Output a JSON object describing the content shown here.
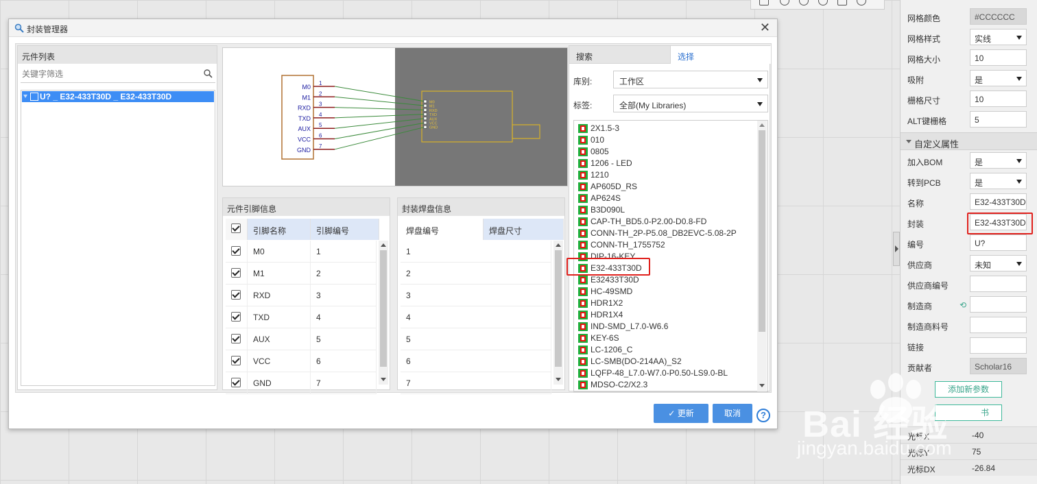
{
  "dialog": {
    "title": "封装管理器",
    "component_list_header": "元件列表",
    "search_placeholder": "关键字筛选",
    "tree_item": "U? _ E32-433T30D _ E32-433T30D",
    "update_label": "更新",
    "cancel_label": "取消",
    "help_label": "?"
  },
  "preview": {
    "pins": [
      {
        "name": "M0",
        "num": "1"
      },
      {
        "name": "M1",
        "num": "2"
      },
      {
        "name": "RXD",
        "num": "3"
      },
      {
        "name": "TXD",
        "num": "4"
      },
      {
        "name": "AUX",
        "num": "5"
      },
      {
        "name": "VCC",
        "num": "6"
      },
      {
        "name": "GND",
        "num": "7"
      }
    ]
  },
  "pin_table": {
    "header": "元件引脚信息",
    "col_name": "引脚名称",
    "col_num": "引脚编号",
    "rows": [
      {
        "name": "M0",
        "num": "1"
      },
      {
        "name": "M1",
        "num": "2"
      },
      {
        "name": "RXD",
        "num": "3"
      },
      {
        "name": "TXD",
        "num": "4"
      },
      {
        "name": "AUX",
        "num": "5"
      },
      {
        "name": "VCC",
        "num": "6"
      },
      {
        "name": "GND",
        "num": "7"
      }
    ]
  },
  "pad_table": {
    "header": "封装焊盘信息",
    "col_num": "焊盘编号",
    "col_size": "焊盘尺寸",
    "rows": [
      "1",
      "2",
      "3",
      "4",
      "5",
      "6",
      "7"
    ]
  },
  "library": {
    "tab_search": "搜索",
    "tab_select": "选择",
    "lib_label": "库别:",
    "lib_value": "工作区",
    "tag_label": "标签:",
    "tag_value": "全部(My Libraries)",
    "items": [
      "2X1.5-3",
      "010",
      "0805",
      "1206 - LED",
      "1210",
      "AP605D_RS",
      "AP624S",
      "B3D090L",
      "CAP-TH_BD5.0-P2.00-D0.8-FD",
      "CONN-TH_2P-P5.08_DB2EVC-5.08-2P",
      "CONN-TH_1755752",
      "DIP-16-KEY",
      "E32-433T30D",
      "E32433T30D",
      "HC-49SMD",
      "HDR1X2",
      "HDR1X4",
      "IND-SMD_L7.0-W6.6",
      "KEY-6S",
      "LC-1206_C",
      "LC-SMB(DO-214AA)_S2",
      "LQFP-48_L7.0-W7.0-P0.50-LS9.0-BL",
      "MDSO-C2/X2.3"
    ],
    "highlighted": "E32-433T30D"
  },
  "properties": {
    "rows": [
      {
        "label": "网格颜色",
        "value": "#CCCCCC",
        "type": "grey"
      },
      {
        "label": "网格样式",
        "value": "实线",
        "type": "select"
      },
      {
        "label": "网格大小",
        "value": "10",
        "type": "input"
      },
      {
        "label": "吸附",
        "value": "是",
        "type": "select"
      },
      {
        "label": "栅格尺寸",
        "value": "10",
        "type": "input"
      },
      {
        "label": "ALT键栅格",
        "value": "5",
        "type": "input"
      }
    ],
    "section": "自定义属性",
    "custom_rows": [
      {
        "label": "加入BOM",
        "value": "是",
        "type": "select"
      },
      {
        "label": "转到PCB",
        "value": "是",
        "type": "select"
      },
      {
        "label": "名称",
        "value": "E32-433T30D",
        "type": "input"
      },
      {
        "label": "封装",
        "value": "E32-433T30D",
        "type": "input"
      },
      {
        "label": "编号",
        "value": "U?",
        "type": "input"
      },
      {
        "label": "供应商",
        "value": "未知",
        "type": "select"
      },
      {
        "label": "供应商编号",
        "value": "",
        "type": "input"
      },
      {
        "label": "制造商",
        "value": "",
        "type": "input"
      },
      {
        "label": "制造商料号",
        "value": "",
        "type": "input"
      },
      {
        "label": "链接",
        "value": "",
        "type": "input"
      },
      {
        "label": "贡献者",
        "value": "Scholar16",
        "type": "grey"
      }
    ],
    "add_param": "添加新参数",
    "second_button": "书",
    "cursor_rows": [
      {
        "label": "光标X",
        "value": "-40"
      },
      {
        "label": "光标Y",
        "value": "75"
      },
      {
        "label": "光标DX",
        "value": "-26.84"
      }
    ]
  },
  "watermark": {
    "line1": "Bai 经验",
    "line2": "jingyan.baidu.com"
  },
  "colors": {
    "accent": "#4a90e2",
    "highlight_red": "#e0201c",
    "tree_select": "#3d8df5",
    "green": "#3aa58b"
  }
}
